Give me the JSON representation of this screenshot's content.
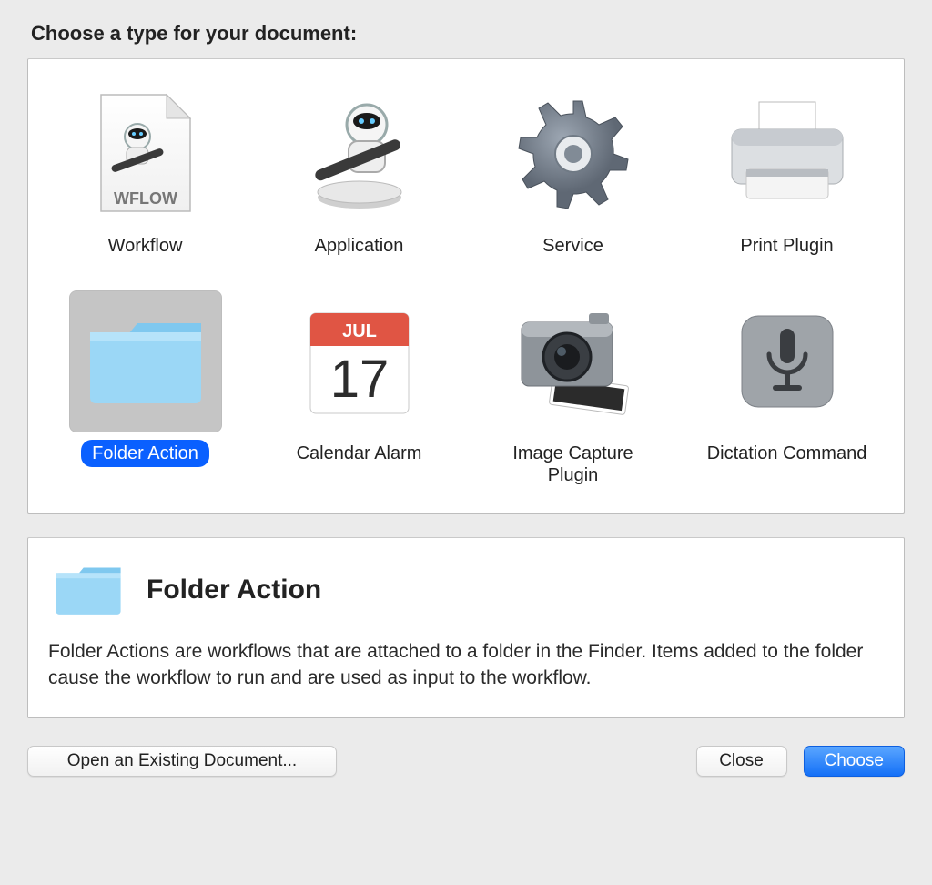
{
  "heading": "Choose a type for your document:",
  "types": [
    {
      "id": "workflow",
      "label": "Workflow",
      "selected": false
    },
    {
      "id": "application",
      "label": "Application",
      "selected": false
    },
    {
      "id": "service",
      "label": "Service",
      "selected": false
    },
    {
      "id": "print-plugin",
      "label": "Print Plugin",
      "selected": false
    },
    {
      "id": "folder-action",
      "label": "Folder Action",
      "selected": true
    },
    {
      "id": "calendar-alarm",
      "label": "Calendar Alarm",
      "selected": false
    },
    {
      "id": "image-capture",
      "label": "Image Capture Plugin",
      "selected": false
    },
    {
      "id": "dictation",
      "label": "Dictation Command",
      "selected": false
    }
  ],
  "calendar_icon": {
    "month": "JUL",
    "day": "17"
  },
  "wflow_badge": "WFLOW",
  "description": {
    "title": "Folder Action",
    "body": "Folder Actions are workflows that are attached to a folder in the Finder. Items added to the folder cause the workflow to run and are used as input to the workflow."
  },
  "buttons": {
    "open": "Open an Existing Document...",
    "close": "Close",
    "choose": "Choose"
  }
}
